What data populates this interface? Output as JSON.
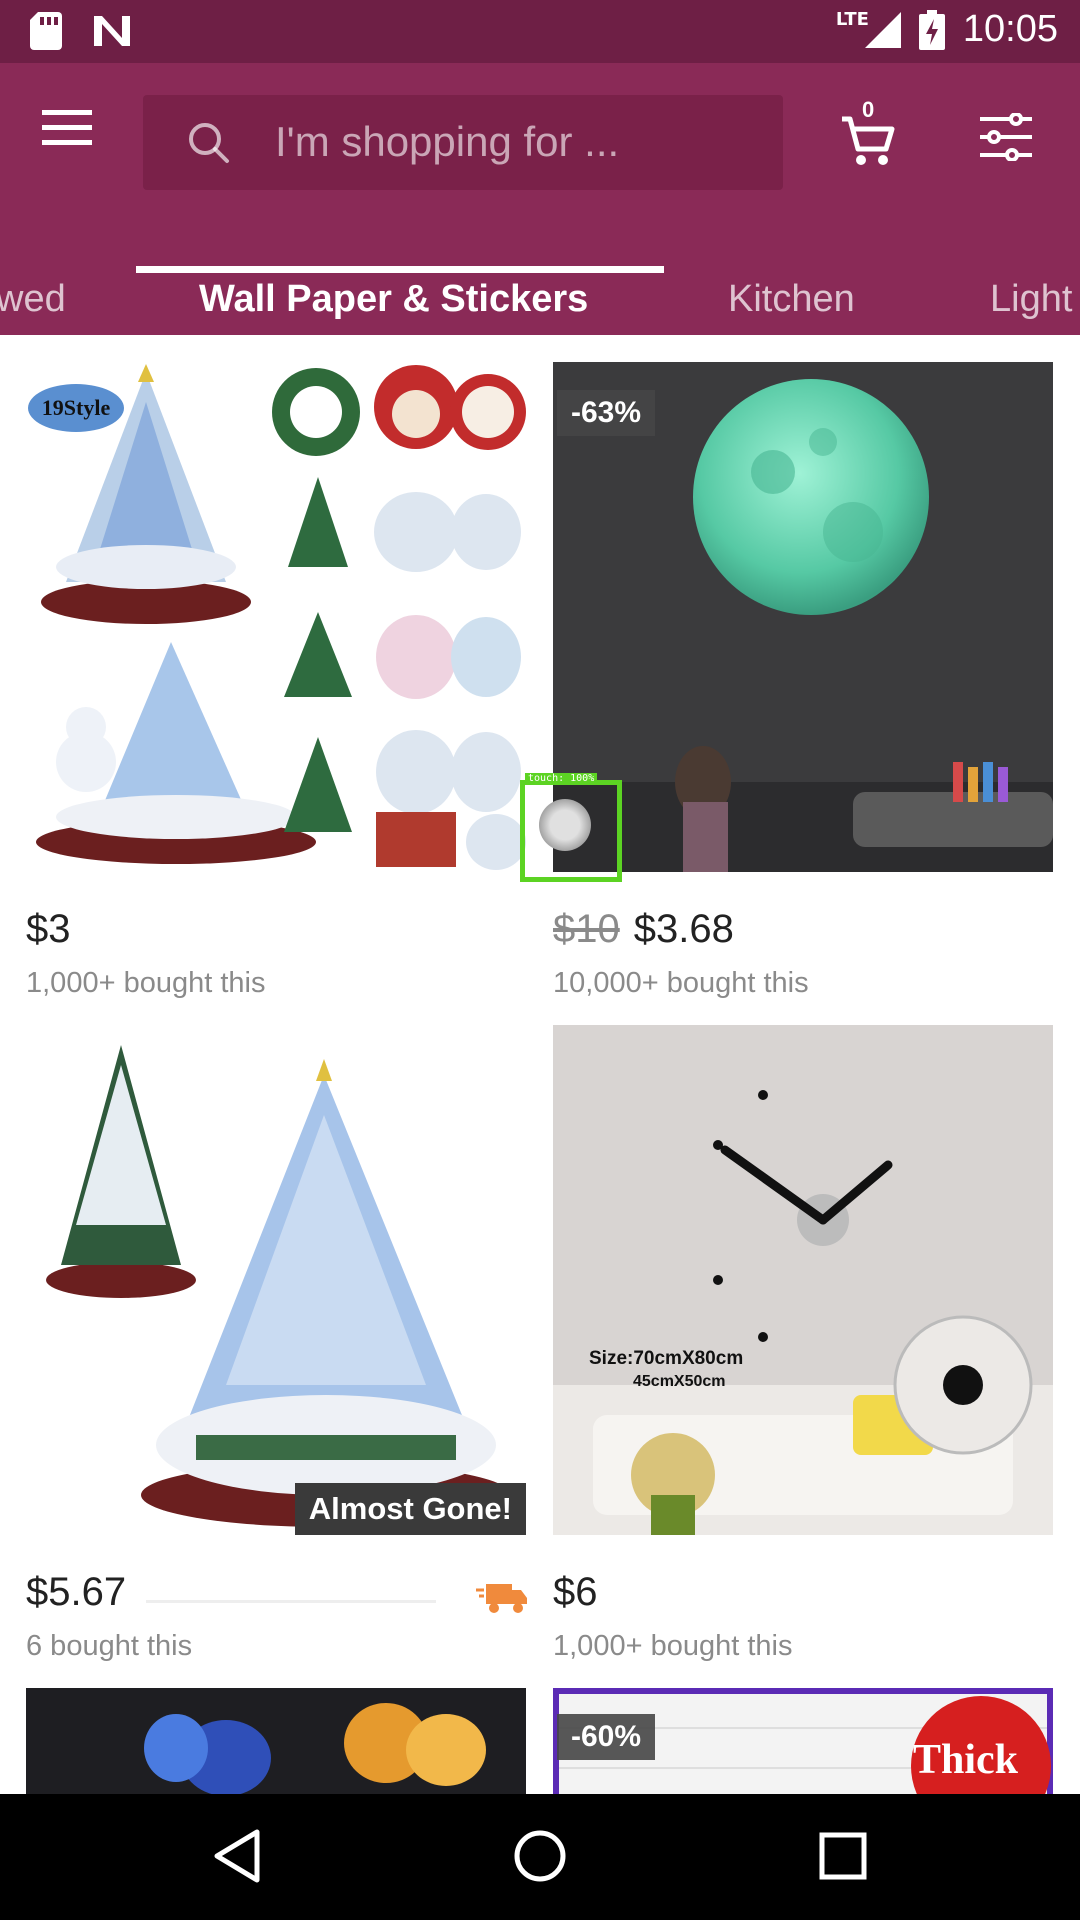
{
  "status_bar": {
    "time": "10:05",
    "network": "LTE"
  },
  "search": {
    "placeholder": "I'm shopping for ..."
  },
  "cart": {
    "count": "0"
  },
  "tabs": [
    {
      "label": "wed"
    },
    {
      "label": "Wall Paper & Stickers",
      "active": true
    },
    {
      "label": "Kitchen"
    },
    {
      "label": "Light"
    }
  ],
  "products": [
    {
      "price": "$3",
      "bought": "1,000+ bought this",
      "tag": "19Style"
    },
    {
      "original_price": "$10",
      "price": "$3.68",
      "bought": "10,000+ bought this",
      "discount": "-63%"
    },
    {
      "price": "$5.67",
      "bought": "6 bought this",
      "badge": "Almost Gone!"
    },
    {
      "price": "$6",
      "bought": "1,000+ bought this",
      "size_text": "Size:70cmX80cm",
      "size_text2": "45cmX50cm"
    },
    {
      "discount": ""
    },
    {
      "discount": "-60%",
      "thick_text": "Thick"
    }
  ],
  "touch": {
    "label": "touch: 100%"
  },
  "colors": {
    "header": "#8a2a57",
    "status_bar": "#6e1f45",
    "accent_truck": "#f08a3c"
  },
  "icons": [
    "menu-icon",
    "search-icon",
    "cart-icon",
    "filter-icon",
    "truck-icon",
    "back-icon",
    "home-icon",
    "recents-icon"
  ]
}
